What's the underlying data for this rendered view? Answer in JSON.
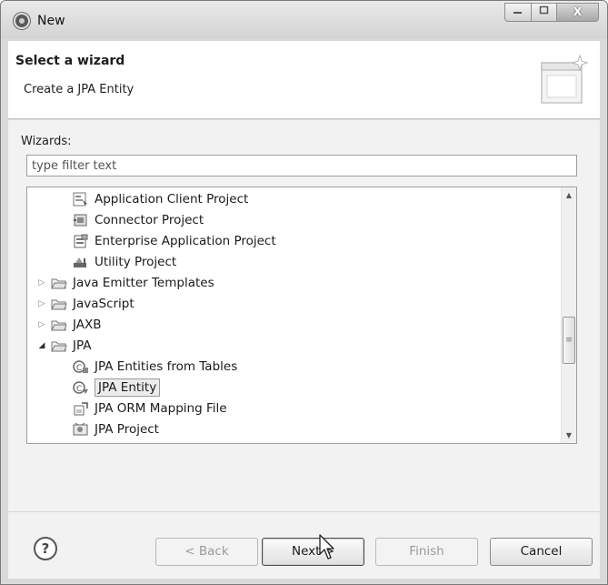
{
  "window": {
    "title": "New",
    "controls": {
      "minimize": "—",
      "maximize": "▢",
      "close": "X"
    }
  },
  "header": {
    "title": "Select a wizard",
    "description": "Create a JPA Entity"
  },
  "wizards": {
    "label": "Wizards:",
    "filter_placeholder": "type filter text"
  },
  "tree": {
    "items": [
      {
        "label": "Application Client Project",
        "icon": "app-client-icon",
        "level": 2,
        "twisty": ""
      },
      {
        "label": "Connector Project",
        "icon": "connector-icon",
        "level": 2,
        "twisty": ""
      },
      {
        "label": "Enterprise Application Project",
        "icon": "enterprise-app-icon",
        "level": 2,
        "twisty": ""
      },
      {
        "label": "Utility Project",
        "icon": "utility-icon",
        "level": 2,
        "twisty": ""
      },
      {
        "label": "Java Emitter Templates",
        "icon": "folder-icon",
        "level": 1,
        "twisty": "▷"
      },
      {
        "label": "JavaScript",
        "icon": "folder-icon",
        "level": 1,
        "twisty": "▷"
      },
      {
        "label": "JAXB",
        "icon": "folder-icon",
        "level": 1,
        "twisty": "▷"
      },
      {
        "label": "JPA",
        "icon": "folder-icon",
        "level": 1,
        "twisty": "◢"
      },
      {
        "label": "JPA Entities from Tables",
        "icon": "jpa-entities-icon",
        "level": 2,
        "twisty": ""
      },
      {
        "label": "JPA Entity",
        "icon": "jpa-entity-icon",
        "level": 2,
        "twisty": "",
        "selected": true
      },
      {
        "label": "JPA ORM Mapping File",
        "icon": "orm-file-icon",
        "level": 2,
        "twisty": ""
      },
      {
        "label": "JPA Project",
        "icon": "jpa-project-icon",
        "level": 2,
        "twisty": ""
      }
    ],
    "scrollbar": {
      "up": "▲",
      "down": "▼",
      "grip": "≡"
    }
  },
  "buttons": {
    "help": "?",
    "back": "< Back",
    "next": "Next >",
    "finish": "Finish",
    "cancel": "Cancel"
  }
}
